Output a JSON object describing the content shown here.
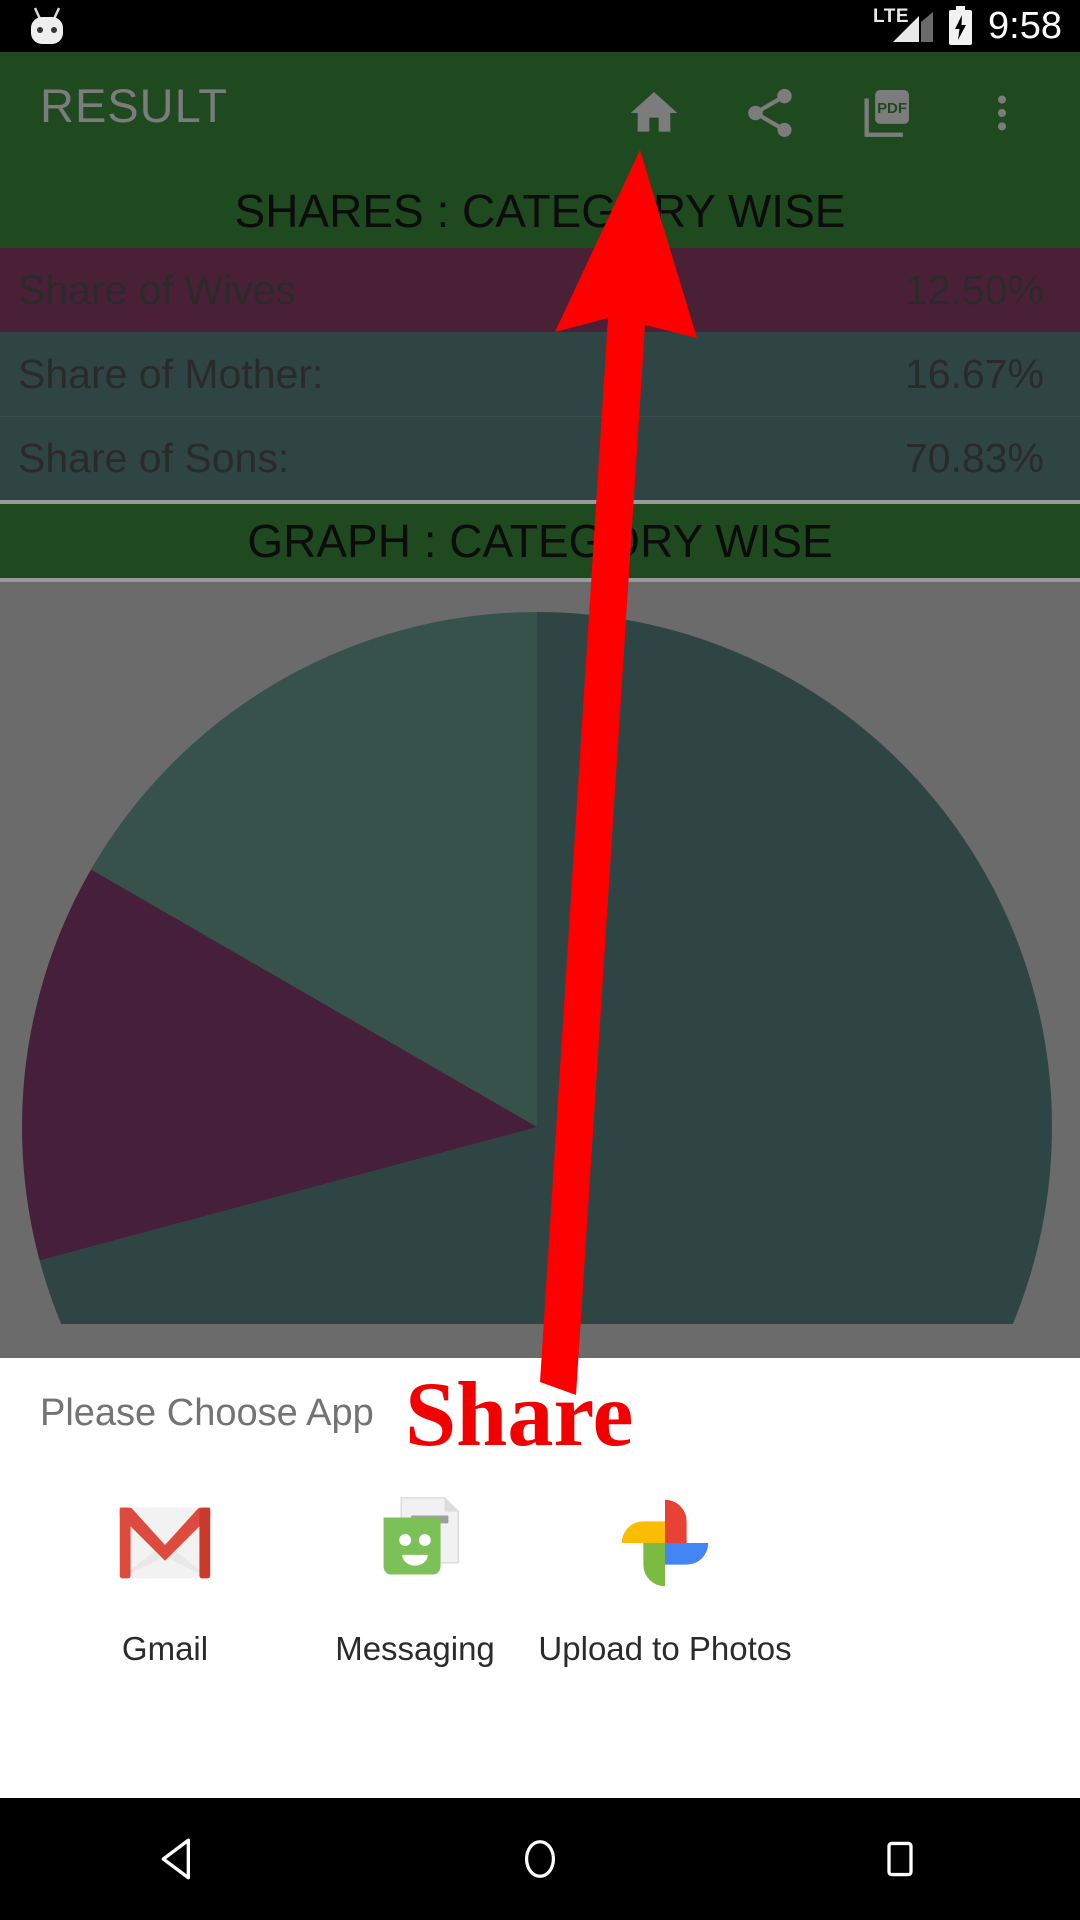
{
  "status_bar": {
    "network_label": "LTE",
    "time": "9:58",
    "icons": [
      "android-head-icon",
      "signal-icon",
      "battery-charging-icon"
    ]
  },
  "app_bar": {
    "title": "RESULT",
    "actions": [
      {
        "name": "home-icon",
        "label": "Home"
      },
      {
        "name": "share-icon",
        "label": "Share"
      },
      {
        "name": "pdf-icon",
        "label": "PDF"
      },
      {
        "name": "overflow-menu-icon",
        "label": "More options"
      }
    ]
  },
  "shares_section": {
    "header": "SHARES : CATEGORY WISE",
    "rows": [
      {
        "label": "Share of Wives",
        "value": "12.50%",
        "style": "purple"
      },
      {
        "label": "Share of Mother:",
        "value": "16.67%",
        "style": "slate"
      },
      {
        "label": "Share of Sons:",
        "value": "70.83%",
        "style": "slate"
      }
    ]
  },
  "graph_section": {
    "header": "GRAPH : CATEGORY WISE"
  },
  "chart_data": {
    "type": "pie",
    "title": "GRAPH : CATEGORY WISE",
    "categories": [
      "Share of Sons",
      "Share of Wives",
      "Share of Mother"
    ],
    "values": [
      70.83,
      12.5,
      16.67
    ],
    "unit": "%",
    "colors": [
      "#2f4544",
      "#46203a",
      "#37514b"
    ],
    "legend": "none",
    "labels_shown": false
  },
  "colors": {
    "app_bar_green": "#1f4a20",
    "row_purple": "#4a2036",
    "row_slate": "#2f4544",
    "scrim_gray": "#6b6b6b",
    "annotation_red": "#f20000"
  },
  "share_dialog": {
    "title": "Please Choose App",
    "annotation": "Share",
    "apps": [
      {
        "name": "Gmail",
        "icon": "gmail-icon"
      },
      {
        "name": "Messaging",
        "icon": "messaging-icon"
      },
      {
        "name": "Upload to Photos",
        "icon": "google-photos-icon"
      }
    ]
  },
  "nav_bar": {
    "buttons": [
      {
        "name": "back-button",
        "label": "Back"
      },
      {
        "name": "home-button",
        "label": "Home"
      },
      {
        "name": "recents-button",
        "label": "Recents"
      }
    ]
  }
}
